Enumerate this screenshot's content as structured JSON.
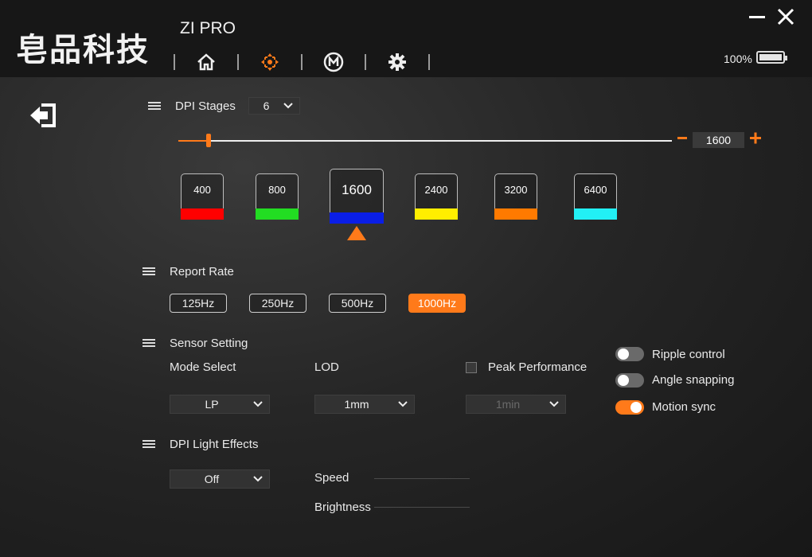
{
  "app": {
    "brand": "皂品科技",
    "model": "ZI PRO",
    "battery": "100%",
    "nav_icons": [
      "home-icon",
      "dpi-icon",
      "macro-icon",
      "settings-icon"
    ],
    "window_controls": [
      "minimize-icon",
      "close-icon"
    ]
  },
  "accent_color": "#ff7a1a",
  "dpi": {
    "section_label": "DPI Stages",
    "stages_count": "6",
    "current_value": "1600",
    "slider_level": 0.06,
    "stages": [
      {
        "value": "400",
        "color": "#ff0000"
      },
      {
        "value": "800",
        "color": "#22dd22"
      },
      {
        "value": "1600",
        "color": "#0a1ee6",
        "selected": true
      },
      {
        "value": "2400",
        "color": "#ffee00"
      },
      {
        "value": "3200",
        "color": "#ff7a00"
      },
      {
        "value": "6400",
        "color": "#22f0f5"
      }
    ]
  },
  "report_rate": {
    "section_label": "Report Rate",
    "options": [
      "125Hz",
      "250Hz",
      "500Hz",
      "1000Hz"
    ],
    "selected": "1000Hz"
  },
  "sensor": {
    "section_label": "Sensor Setting",
    "mode_label": "Mode Select",
    "mode_value": "LP",
    "lod_label": "LOD",
    "lod_value": "1mm",
    "peak_label": "Peak Performance",
    "peak_value": "1min",
    "toggles": [
      {
        "label": "Ripple control",
        "on": false
      },
      {
        "label": "Angle snapping",
        "on": false
      },
      {
        "label": "Motion sync",
        "on": true
      }
    ]
  },
  "light": {
    "section_label": "DPI Light Effects",
    "effect_value": "Off",
    "speed_label": "Speed",
    "brightness_label": "Brightness"
  }
}
